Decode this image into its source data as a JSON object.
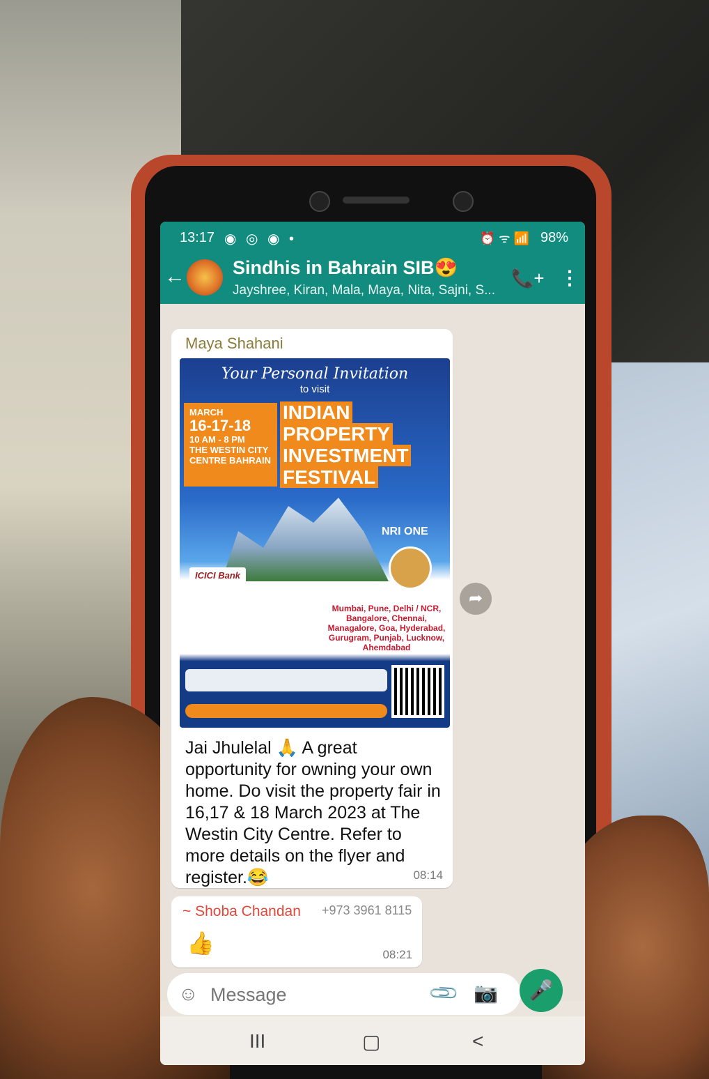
{
  "status_bar": {
    "time": "13:17",
    "notification_icons": "◉ ◎ ◉ •",
    "system_icons": "⏰ ᯤ 📶",
    "battery": "98%"
  },
  "header": {
    "back_icon": "←",
    "group_name": "Sindhis in Bahrain SIB😍",
    "members": "Jayshree, Kiran, Mala, Maya, Nita, Sajni, S...",
    "add_call_icon": "📞+",
    "more_icon": "⋮"
  },
  "messages": [
    {
      "sender": "Maya Shahani",
      "flyer": {
        "invitation": "Your Personal Invitation",
        "to_visit": "to visit",
        "month": "MARCH",
        "days": "16-17-18",
        "hours": "10 AM - 8 PM",
        "venue": "THE WESTIN CITY CENTRE BAHRAIN",
        "title_1": "INDIAN",
        "title_2": "PROPERTY",
        "title_3": "INVESTMENT",
        "title_4": "FESTIVAL",
        "partner": "NRI ONE",
        "bank": "ICICI Bank",
        "cities": "Mumbai, Pune, Delhi / NCR, Bangalore, Chennai, Managalore, Goa, Hyderabad, Gurugram, Punjab, Lucknow, Ahemdabad"
      },
      "text": "Jai Jhulelal 🙏 A great opportunity for owning your own home. Do visit the property fair in 16,17 & 18 March 2023 at The Westin City Centre. Refer to more details on the flyer and register.😂",
      "time": "08:14"
    },
    {
      "sender": "~ Shoba Chandan",
      "phone": "+973 3961 8115",
      "text": "👍",
      "time": "08:21"
    }
  ],
  "composer": {
    "placeholder": "Message",
    "emoji_icon": "☺",
    "attach_icon": "📎",
    "camera_icon": "📷",
    "mic_icon": "🎤"
  },
  "share_icon": "➦",
  "nav": {
    "recents": "III",
    "home": "▢",
    "back": "<"
  },
  "colors": {
    "header": "#128c7e",
    "mic": "#1a9e6b",
    "chat_bg": "#e8e2da"
  }
}
